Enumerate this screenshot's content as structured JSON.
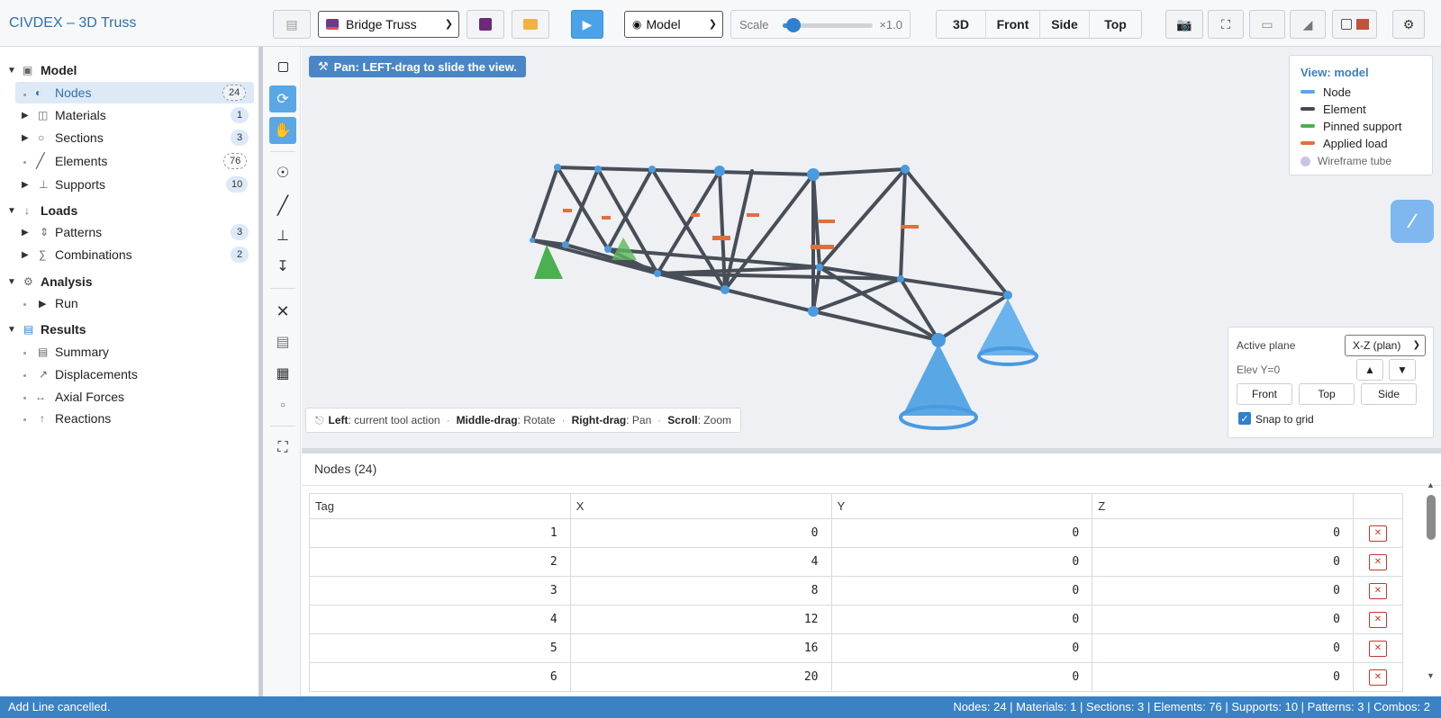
{
  "app": {
    "title": "CIVDEX – 3D Truss"
  },
  "toolbar": {
    "model_selected": "Bridge Truss",
    "mode_selected": "Model",
    "scale_label": "Scale",
    "scale_value": "×1.0",
    "scale_fraction": 0.12,
    "views": [
      "3D",
      "Front",
      "Side",
      "Top"
    ],
    "active_view": "3D"
  },
  "sidebar": {
    "groups": [
      {
        "label": "Model",
        "items": [
          {
            "label": "Nodes",
            "count": "24"
          },
          {
            "label": "Materials",
            "count": "1"
          },
          {
            "label": "Sections",
            "count": "3"
          },
          {
            "label": "Elements",
            "count": "76"
          },
          {
            "label": "Supports",
            "count": "10"
          }
        ]
      },
      {
        "label": "Loads",
        "items": [
          {
            "label": "Patterns",
            "count": "3"
          },
          {
            "label": "Combinations",
            "count": "2"
          }
        ]
      },
      {
        "label": "Analysis",
        "items": [
          {
            "label": "Run"
          }
        ]
      },
      {
        "label": "Results",
        "items": [
          {
            "label": "Summary"
          },
          {
            "label": "Displacements"
          },
          {
            "label": "Axial Forces"
          },
          {
            "label": "Reactions"
          }
        ]
      }
    ]
  },
  "viewport": {
    "hint": "Pan: LEFT-drag to slide the view.",
    "legend": {
      "title": "View: model",
      "items": [
        {
          "label": "Node",
          "color": "#5aa7e6"
        },
        {
          "label": "Element",
          "color": "#444a52"
        },
        {
          "label": "Pinned support",
          "color": "#4caf50"
        },
        {
          "label": "Applied load",
          "color": "#e0703a"
        }
      ],
      "extra": "Wireframe tube"
    },
    "plane_panel": {
      "active_plane_label": "Active plane",
      "active_plane_value": "X-Z (plan)",
      "elev_label": "Elev Y=0",
      "up": "▲",
      "down": "▼",
      "buttons": [
        "Front",
        "Top",
        "Side"
      ],
      "snap_label": "Snap to grid"
    },
    "help": {
      "left_key": "Left",
      "left_text": ": current tool action",
      "middle_key": "Middle-drag",
      "middle_text": ": Rotate",
      "right_key": "Right-drag",
      "right_text": ": Pan",
      "scroll_key": "Scroll",
      "scroll_text": ": Zoom"
    }
  },
  "table": {
    "title": "Nodes (24)",
    "columns": [
      "Tag",
      "X",
      "Y",
      "Z"
    ],
    "rows": [
      [
        "1",
        "0",
        "0",
        "0"
      ],
      [
        "2",
        "4",
        "0",
        "0"
      ],
      [
        "3",
        "8",
        "0",
        "0"
      ],
      [
        "4",
        "12",
        "0",
        "0"
      ],
      [
        "5",
        "16",
        "0",
        "0"
      ],
      [
        "6",
        "20",
        "0",
        "0"
      ]
    ]
  },
  "status": {
    "left": "Add Line cancelled.",
    "right": "Nodes: 24 | Materials: 1 | Sections: 3 | Elements: 76 | Supports: 10 | Patterns: 3 | Combos: 2"
  }
}
